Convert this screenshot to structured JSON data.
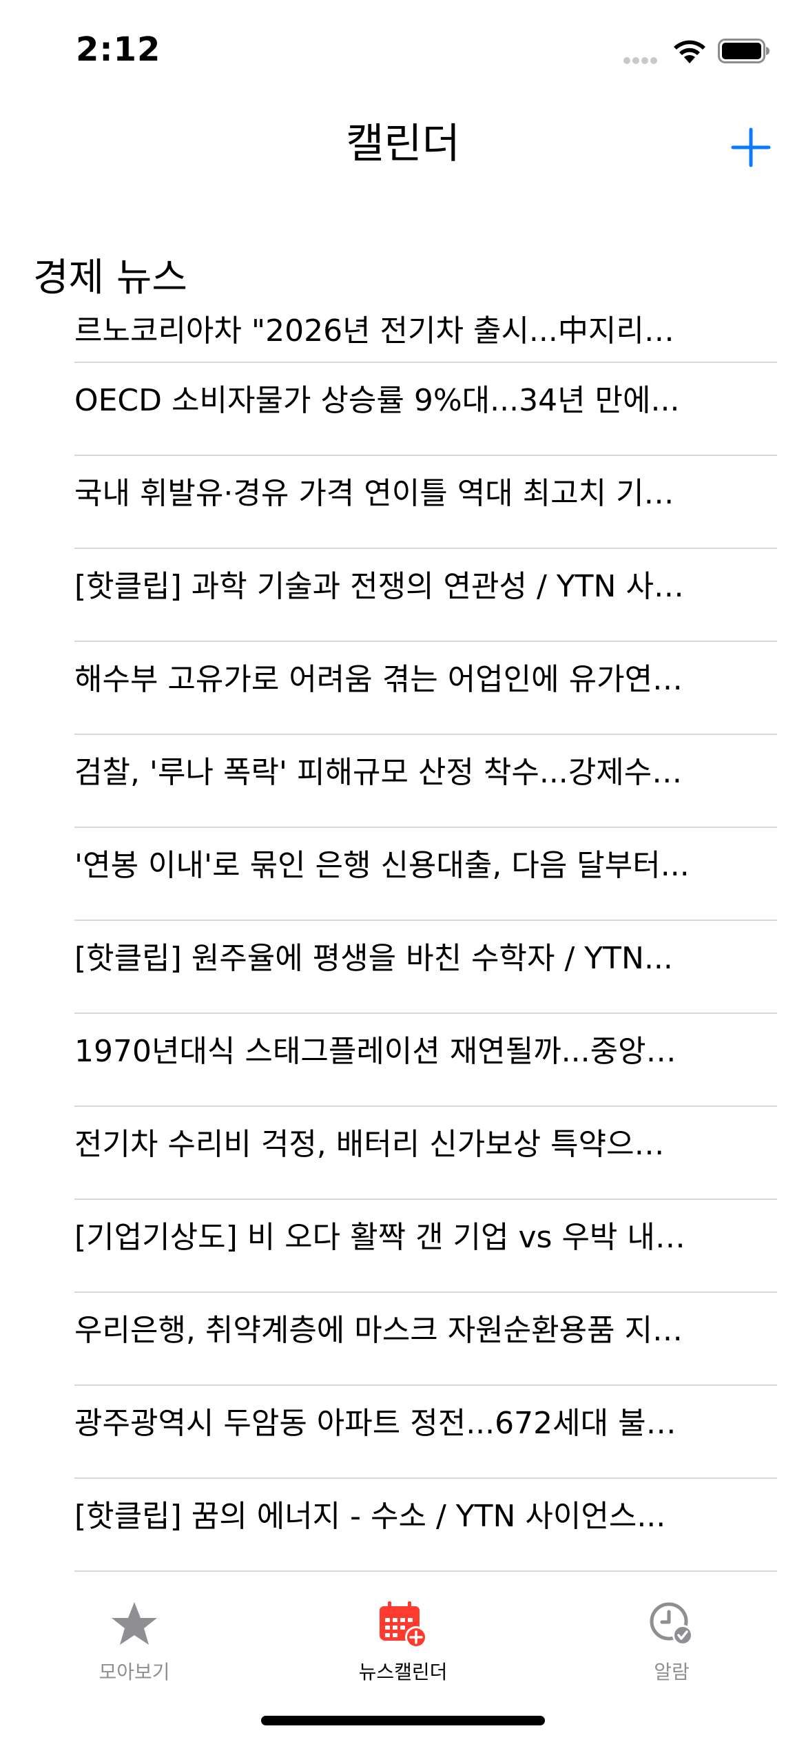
{
  "status_bar": {
    "time": "2:12"
  },
  "nav": {
    "title": "캘린더",
    "add_icon": "plus-icon"
  },
  "section": {
    "header": "경제 뉴스"
  },
  "news_items": [
    {
      "title": "르노코리아차 \"2026년 전기차 출시...中지리…"
    },
    {
      "title": "OECD 소비자물가 상승률 9%대...34년 만에..."
    },
    {
      "title": "국내 휘발유·경유 가격 연이틀 역대 최고치 기…"
    },
    {
      "title": "[핫클립] 과학 기술과 전쟁의 연관성 / YTN 사…"
    },
    {
      "title": "해수부 고유가로 어려움 겪는 어업인에 유가연…"
    },
    {
      "title": "검찰, '루나 폭락' 피해규모 산정 착수...강제수…"
    },
    {
      "title": "'연봉 이내'로 묶인 은행 신용대출, 다음 달부터..."
    },
    {
      "title": "[핫클립] 원주율에 평생을 바친 수학자 / YTN..."
    },
    {
      "title": "1970년대식 스태그플레이션 재연될까...중앙…"
    },
    {
      "title": "전기차 수리비 걱정, 배터리 신가보상 특약으…"
    },
    {
      "title": "[기업기상도] 비 오다 활짝 갠 기업 vs 우박 내…"
    },
    {
      "title": "우리은행, 취약계층에 마스크 자원순환용품 지…"
    },
    {
      "title": "광주광역시 두암동 아파트 정전...672세대 불…"
    },
    {
      "title": "[핫클립] 꿈의 에너지 - 수소 / YTN 사이언스..."
    }
  ],
  "tabs": [
    {
      "label": "모아보기",
      "icon": "star-icon",
      "active": false
    },
    {
      "label": "뉴스캘린더",
      "icon": "calendar-add-icon",
      "active": true
    },
    {
      "label": "알람",
      "icon": "clock-check-icon",
      "active": false
    }
  ],
  "colors": {
    "accent": "#0a7aff",
    "calendar_red": "#ff3b30",
    "tab_inactive": "#8e8e93",
    "separator": "#d8d8dc"
  }
}
